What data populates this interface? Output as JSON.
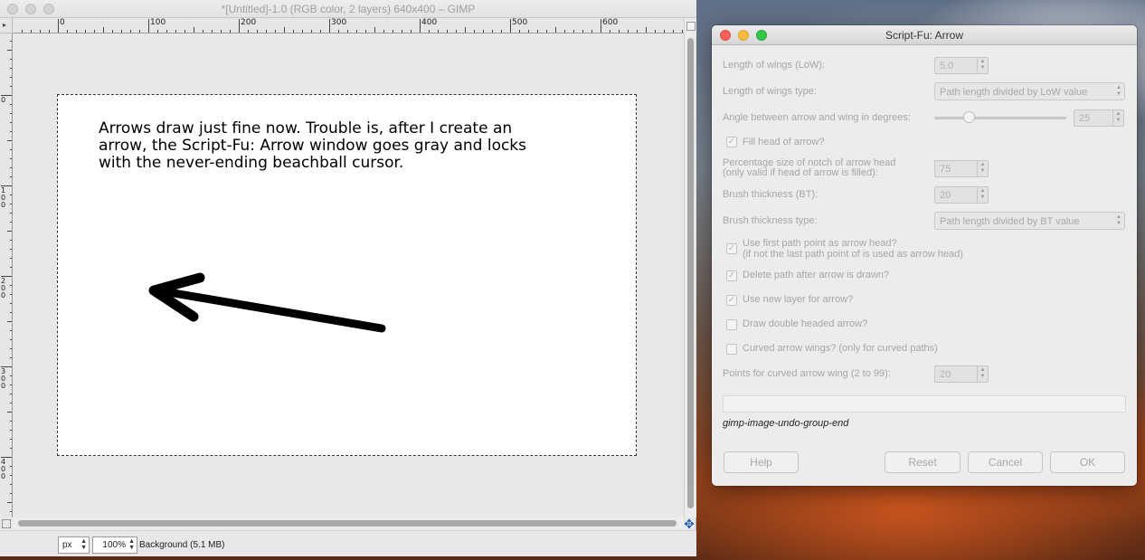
{
  "gimp": {
    "title": "*[Untitled]-1.0 (RGB color, 2 layers) 640x400 – GIMP",
    "ruler_h_labels": [
      "0",
      "100",
      "200",
      "300",
      "400",
      "500",
      "600"
    ],
    "ruler_v_labels": [
      "0",
      "1\n0\n0",
      "2\n0\n0",
      "3\n0\n0",
      "4\n0\n0"
    ],
    "canvas_text": "Arrows draw just fine now. Trouble is, after I create an arrow, the Script-Fu: Arrow window goes gray and locks with the never-ending beachball cursor.",
    "status": {
      "unit": "px",
      "zoom": "100%",
      "layer_info": "Background (5.1 MB)"
    }
  },
  "dialog": {
    "title": "Script-Fu: Arrow",
    "fields": {
      "low_label": "Length of wings (LoW):",
      "low_value": "5.0",
      "low_type_label": "Length of wings type:",
      "low_type_value": "Path length divided by LoW value",
      "angle_label": "Angle between arrow and wing in degrees:",
      "angle_value": "25",
      "fill_head_label": "Fill head of arrow?",
      "notch_label_1": "Percentage size of notch of arrow head",
      "notch_label_2": "(only valid if head of arrow is filled):",
      "notch_value": "75",
      "bt_label": "Brush thickness (BT):",
      "bt_value": "20",
      "bt_type_label": "Brush thickness type:",
      "bt_type_value": "Path length divided by BT value",
      "first_point_label_1": "Use first path point as arrow head?",
      "first_point_label_2": "(if not the last path point of is used as arrow head)",
      "delete_path_label": "Delete path after arrow is drawn?",
      "new_layer_label": "Use new layer for arrow?",
      "double_head_label": "Draw double headed arrow?",
      "curved_label": "Curved arrow wings? (only for curved paths)",
      "curve_points_label": "Points for curved arrow wing (2 to 99):",
      "curve_points_value": "20"
    },
    "checkboxes": {
      "fill_head": true,
      "first_point": true,
      "delete_path": true,
      "new_layer": true,
      "double_head": false,
      "curved": false
    },
    "progress_text": "gimp-image-undo-group-end",
    "buttons": {
      "help": "Help",
      "reset": "Reset",
      "cancel": "Cancel",
      "ok": "OK"
    }
  },
  "icons": {
    "checkmark": "✓",
    "spin_up": "▲",
    "spin_down": "▼",
    "navigate": "✥"
  },
  "colors": {
    "close": "#fc605c",
    "minimize": "#fdbc40",
    "zoom": "#34c84a"
  }
}
